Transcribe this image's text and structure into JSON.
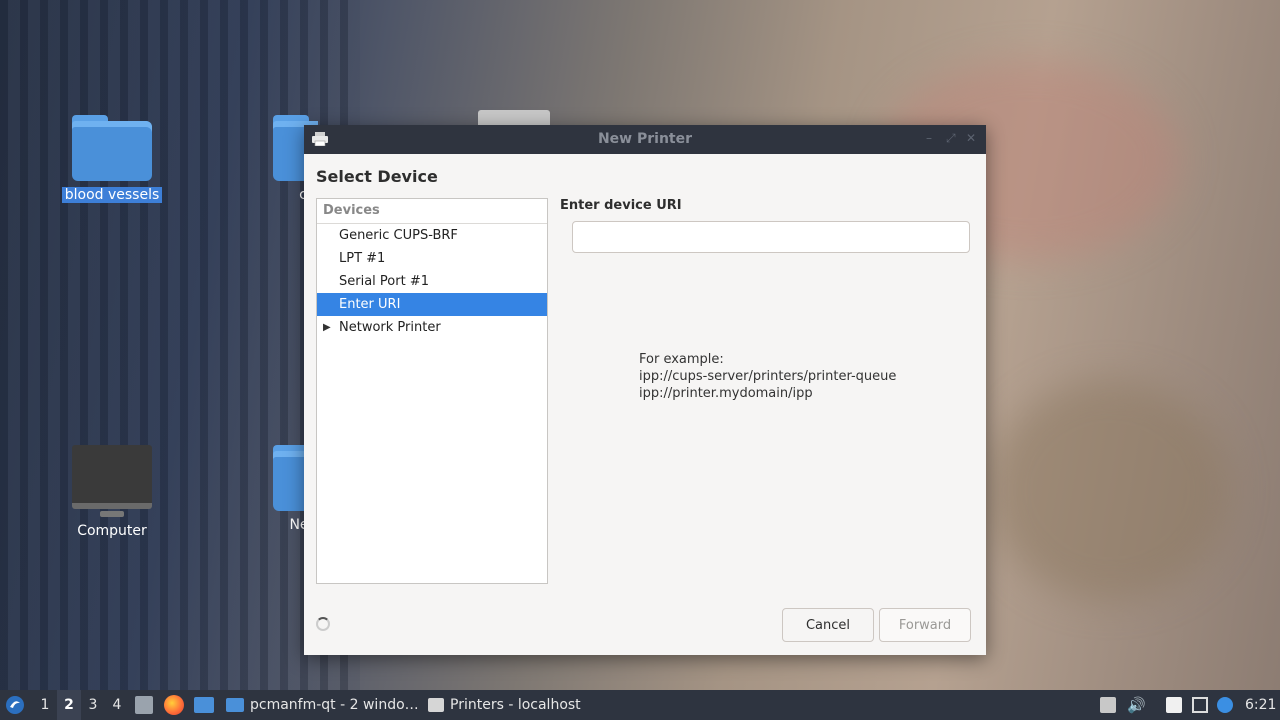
{
  "desktop": {
    "icons": [
      {
        "label": "blood vessels",
        "icon": "folder-icon",
        "selected": true
      },
      {
        "label": "Computer",
        "icon": "computer-icon",
        "selected": false
      },
      {
        "label": "c",
        "icon": "folder-icon",
        "selected": false
      },
      {
        "label": "Ne",
        "icon": "folder-icon",
        "selected": false
      }
    ]
  },
  "window": {
    "title": "New Printer",
    "heading": "Select Device",
    "devices_header": "Devices",
    "devices": [
      {
        "label": "Generic CUPS-BRF",
        "selected": false,
        "expandable": false
      },
      {
        "label": "LPT #1",
        "selected": false,
        "expandable": false
      },
      {
        "label": "Serial Port #1",
        "selected": false,
        "expandable": false
      },
      {
        "label": "Enter URI",
        "selected": true,
        "expandable": false
      },
      {
        "label": "Network Printer",
        "selected": false,
        "expandable": true
      }
    ],
    "uri_label": "Enter device URI",
    "uri_value": "",
    "example_lines": [
      "For example:",
      "ipp://cups-server/printers/printer-queue",
      "ipp://printer.mydomain/ipp"
    ],
    "cancel_label": "Cancel",
    "forward_label": "Forward"
  },
  "taskbar": {
    "workspaces": [
      "1",
      "2",
      "3",
      "4"
    ],
    "active_workspace": "2",
    "tasks": [
      {
        "label": "pcmanfm-qt - 2 windo…",
        "icon": "folder-icon"
      },
      {
        "label": "Printers - localhost",
        "icon": "printer-icon"
      }
    ],
    "clock": "6:21"
  },
  "colors": {
    "selection": "#3584e4",
    "titlebar": "#2f343f",
    "taskbar": "#2e3440"
  }
}
